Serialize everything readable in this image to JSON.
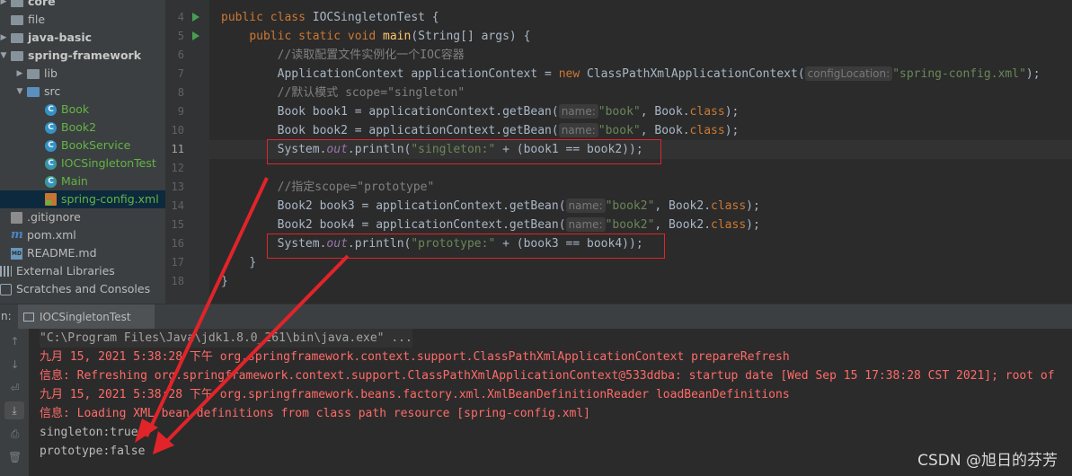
{
  "project_tree": {
    "items": [
      {
        "label": "core",
        "type": "folder",
        "bold": true,
        "arrow": "▶"
      },
      {
        "label": "file",
        "type": "folder",
        "bold": false,
        "arrow": ""
      },
      {
        "label": "java-basic",
        "type": "folder",
        "bold": true,
        "arrow": "▶"
      },
      {
        "label": "spring-framework",
        "type": "folder",
        "bold": true,
        "arrow": "▼"
      },
      {
        "label": "lib",
        "type": "folder",
        "bold": false,
        "arrow": "▶"
      },
      {
        "label": "src",
        "type": "folder-blue",
        "bold": false,
        "arrow": "▼"
      },
      {
        "label": "Book",
        "type": "class",
        "bold": false,
        "arrow": ""
      },
      {
        "label": "Book2",
        "type": "class",
        "bold": false,
        "arrow": ""
      },
      {
        "label": "BookService",
        "type": "class",
        "bold": false,
        "arrow": ""
      },
      {
        "label": "IOCSingletonTest",
        "type": "class-run",
        "bold": false,
        "arrow": ""
      },
      {
        "label": "Main",
        "type": "class-run",
        "bold": false,
        "arrow": ""
      },
      {
        "label": "spring-config.xml",
        "type": "xml",
        "bold": false,
        "arrow": "",
        "selected": true
      },
      {
        "label": ".gitignore",
        "type": "git",
        "bold": false,
        "arrow": ""
      },
      {
        "label": "pom.xml",
        "type": "maven",
        "bold": false,
        "arrow": ""
      },
      {
        "label": "README.md",
        "type": "md",
        "bold": false,
        "arrow": ""
      },
      {
        "label": "External Libraries",
        "type": "libs",
        "bold": false,
        "arrow": ""
      },
      {
        "label": "Scratches and Consoles",
        "type": "scratch",
        "bold": false,
        "arrow": ""
      }
    ]
  },
  "editor": {
    "line_numbers": [
      "4",
      "5",
      "6",
      "7",
      "8",
      "9",
      "10",
      "11",
      "12",
      "13",
      "14",
      "15",
      "16",
      "17",
      "18"
    ],
    "current_line": "11",
    "lines": {
      "l4": {
        "kw1": "public class ",
        "name": "IOCSingletonTest {"
      },
      "l5": {
        "kw1": "public static void ",
        "name": "main",
        "rest": "(String[] args) {"
      },
      "l6": {
        "comment": "//读取配置文件实例化一个IOC容器"
      },
      "l7": {
        "a": "ApplicationContext applicationContext = ",
        "kw": "new ",
        "b": "ClassPathXmlApplicationContext(",
        "hint": "configLocation:",
        "str": "\"spring-config.xml\"",
        "c": ");"
      },
      "l8": {
        "comment": "//默认模式 scope=\"singleton\""
      },
      "l9": {
        "a": "Book book1 = applicationContext.getBean(",
        "hint": "name:",
        "str": "\"book\"",
        "b": ", Book.",
        "kw": "class",
        "c": ");"
      },
      "l10": {
        "a": "Book book2 = applicationContext.getBean(",
        "hint": "name:",
        "str": "\"book\"",
        "b": ", Book.",
        "kw": "class",
        "c": ");"
      },
      "l11": {
        "a": "System.",
        "field": "out",
        "b": ".println(",
        "str": "\"singleton:\"",
        "c": " + (book1 == book2));"
      },
      "l13": {
        "comment": "//指定scope=\"prototype\""
      },
      "l14": {
        "a": "Book2 book3 = applicationContext.getBean(",
        "hint": "name:",
        "str": "\"book2\"",
        "b": ", Book2.",
        "kw": "class",
        "c": ");"
      },
      "l15": {
        "a": "Book2 book4 = applicationContext.getBean(",
        "hint": "name:",
        "str": "\"book2\"",
        "b": ", Book2.",
        "kw": "class",
        "c": ");"
      },
      "l16": {
        "a": "System.",
        "field": "out",
        "b": ".println(",
        "str": "\"prototype:\"",
        "c": " + (book3 == book4));"
      },
      "l17": {
        "text": "}"
      },
      "l18": {
        "text": "}"
      }
    }
  },
  "run_window": {
    "label": "n:",
    "tab_label": "IOCSingletonTest",
    "toolbar_icons": [
      "up-arrow-icon",
      "down-arrow-icon",
      "soft-wrap-icon",
      "scroll-to-end-icon",
      "print-icon",
      "trash-icon"
    ],
    "console": [
      {
        "text": "\"C:\\Program Files\\Java\\jdk1.8.0_261\\bin\\java.exe\" ...",
        "style": "cmd"
      },
      {
        "text": "九月 15, 2021 5:38:28 下午 org.springframework.context.support.ClassPathXmlApplicationContext prepareRefresh",
        "style": "red"
      },
      {
        "text": "信息: Refreshing org.springframework.context.support.ClassPathXmlApplicationContext@533ddba: startup date [Wed Sep 15 17:38:28 CST 2021]; root of",
        "style": "red"
      },
      {
        "text": "九月 15, 2021 5:38:28 下午 org.springframework.beans.factory.xml.XmlBeanDefinitionReader loadBeanDefinitions",
        "style": "red"
      },
      {
        "text": "信息: Loading XML bean definitions from class path resource [spring-config.xml]",
        "style": "red"
      },
      {
        "text": "singleton:true",
        "style": "normal"
      },
      {
        "text": "prototype:false",
        "style": "normal"
      }
    ]
  },
  "watermark": "CSDN @旭日的芬芳",
  "colors": {
    "annotation_red": "#e0242a",
    "keyword": "#cc7832",
    "string": "#6a8759",
    "comment": "#808080",
    "field": "#9876aa"
  }
}
